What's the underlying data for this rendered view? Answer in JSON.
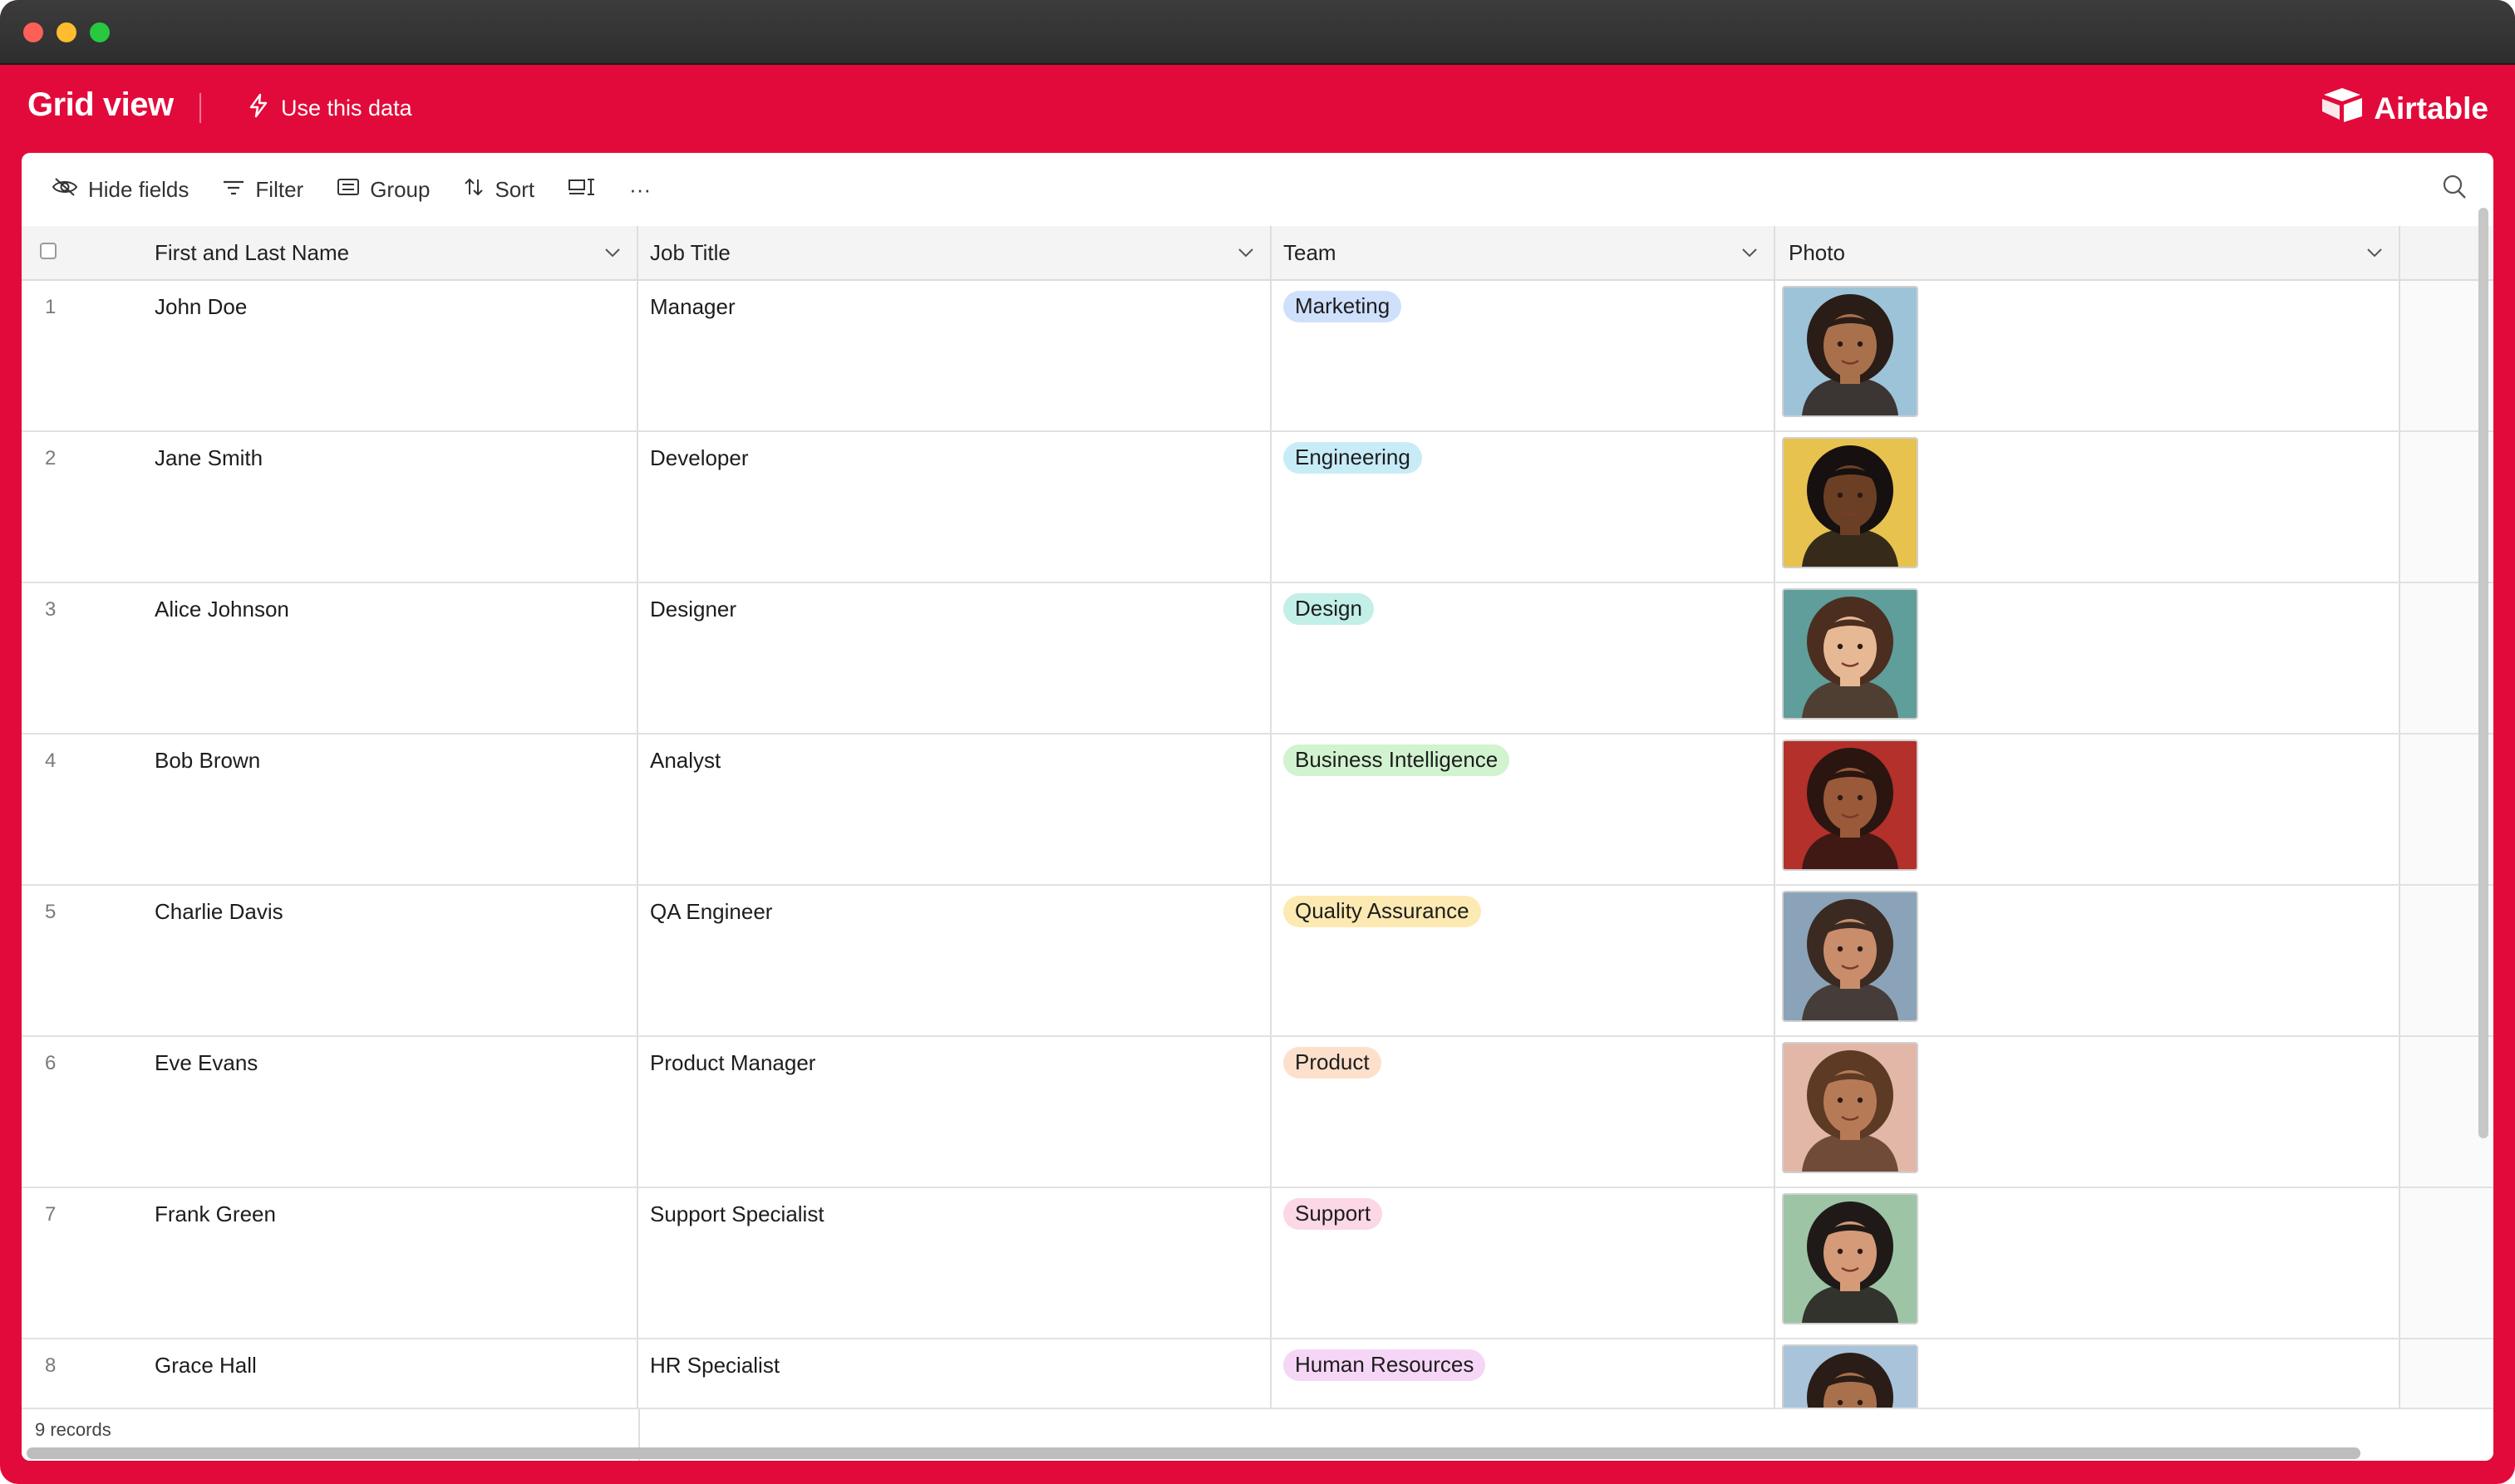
{
  "app": {
    "view_title": "Grid view",
    "use_data_label": "Use this data",
    "brand_name": "Airtable",
    "brand_color": "#e20a3a"
  },
  "toolbar": {
    "hide_fields_label": "Hide fields",
    "filter_label": "Filter",
    "group_label": "Group",
    "sort_label": "Sort",
    "row_height_icon": "row-height-icon",
    "more_label": "···",
    "search_icon": "search-icon"
  },
  "table": {
    "columns": [
      "First and Last Name",
      "Job Title",
      "Team",
      "Photo"
    ],
    "rows": [
      {
        "num": "1",
        "name": "John Doe",
        "job": "Manager",
        "team": "Marketing",
        "team_color": "#cfe0fb",
        "photo": "avatar-photo"
      },
      {
        "num": "2",
        "name": "Jane Smith",
        "job": "Developer",
        "team": "Engineering",
        "team_color": "#c7ecf8",
        "photo": "avatar-photo"
      },
      {
        "num": "3",
        "name": "Alice Johnson",
        "job": "Designer",
        "team": "Design",
        "team_color": "#c2efe8",
        "photo": "avatar-photo"
      },
      {
        "num": "4",
        "name": "Bob Brown",
        "job": "Analyst",
        "team": "Business Intelligence",
        "team_color": "#d1f3cf",
        "photo": "avatar-photo"
      },
      {
        "num": "5",
        "name": "Charlie Davis",
        "job": "QA Engineer",
        "team": "Quality Assurance",
        "team_color": "#fdeab2",
        "photo": "avatar-photo"
      },
      {
        "num": "6",
        "name": "Eve Evans",
        "job": "Product Manager",
        "team": "Product",
        "team_color": "#fde0cc",
        "photo": "avatar-photo"
      },
      {
        "num": "7",
        "name": "Frank Green",
        "job": "Support Specialist",
        "team": "Support",
        "team_color": "#fcd7e5",
        "photo": "avatar-photo"
      },
      {
        "num": "8",
        "name": "Grace Hall",
        "job": "HR Specialist",
        "team": "Human Resources",
        "team_color": "#f6d6f6",
        "photo": "avatar-photo"
      }
    ],
    "avatar_backgrounds": [
      "#9dc3d8",
      "#e8c24f",
      "#5f9e9a",
      "#b3302b",
      "#8ba3b8",
      "#e3b7a8",
      "#9ec4a6",
      "#a9c4da"
    ],
    "avatar_skin": [
      "#a8704b",
      "#6b3f24",
      "#e6b894",
      "#9a5a3a",
      "#c98d6c",
      "#b77a57",
      "#d59a77",
      "#a8704b"
    ],
    "avatar_hair": [
      "#2a1c17",
      "#161010",
      "#4b2e20",
      "#2b1511",
      "#3a2a22",
      "#5c3a24",
      "#1f1a18",
      "#2a1c17"
    ]
  },
  "footer": {
    "records_label": "9 records"
  }
}
